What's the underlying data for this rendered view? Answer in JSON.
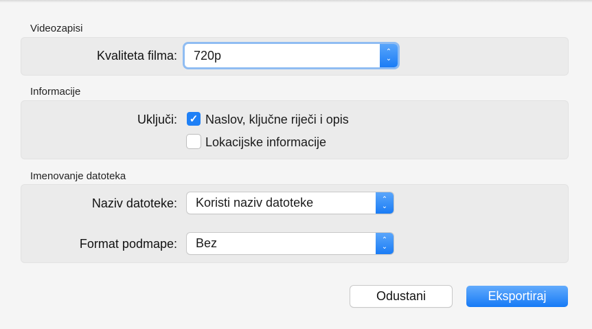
{
  "video": {
    "section": "Videozapisi",
    "quality_label": "Kvaliteta filma:",
    "quality_value": "720p"
  },
  "info": {
    "section": "Informacije",
    "include_label": "Uključi:",
    "options": [
      {
        "label": "Naslov, ključne riječi i opis",
        "checked": true
      },
      {
        "label": "Lokacijske informacije",
        "checked": false
      }
    ]
  },
  "naming": {
    "section": "Imenovanje datoteka",
    "filename_label": "Naziv datoteke:",
    "filename_value": "Koristi naziv datoteke",
    "subfolder_label": "Format podmape:",
    "subfolder_value": "Bez"
  },
  "buttons": {
    "cancel": "Odustani",
    "export": "Eksportiraj"
  },
  "colors": {
    "accent": "#1a7cf5"
  }
}
